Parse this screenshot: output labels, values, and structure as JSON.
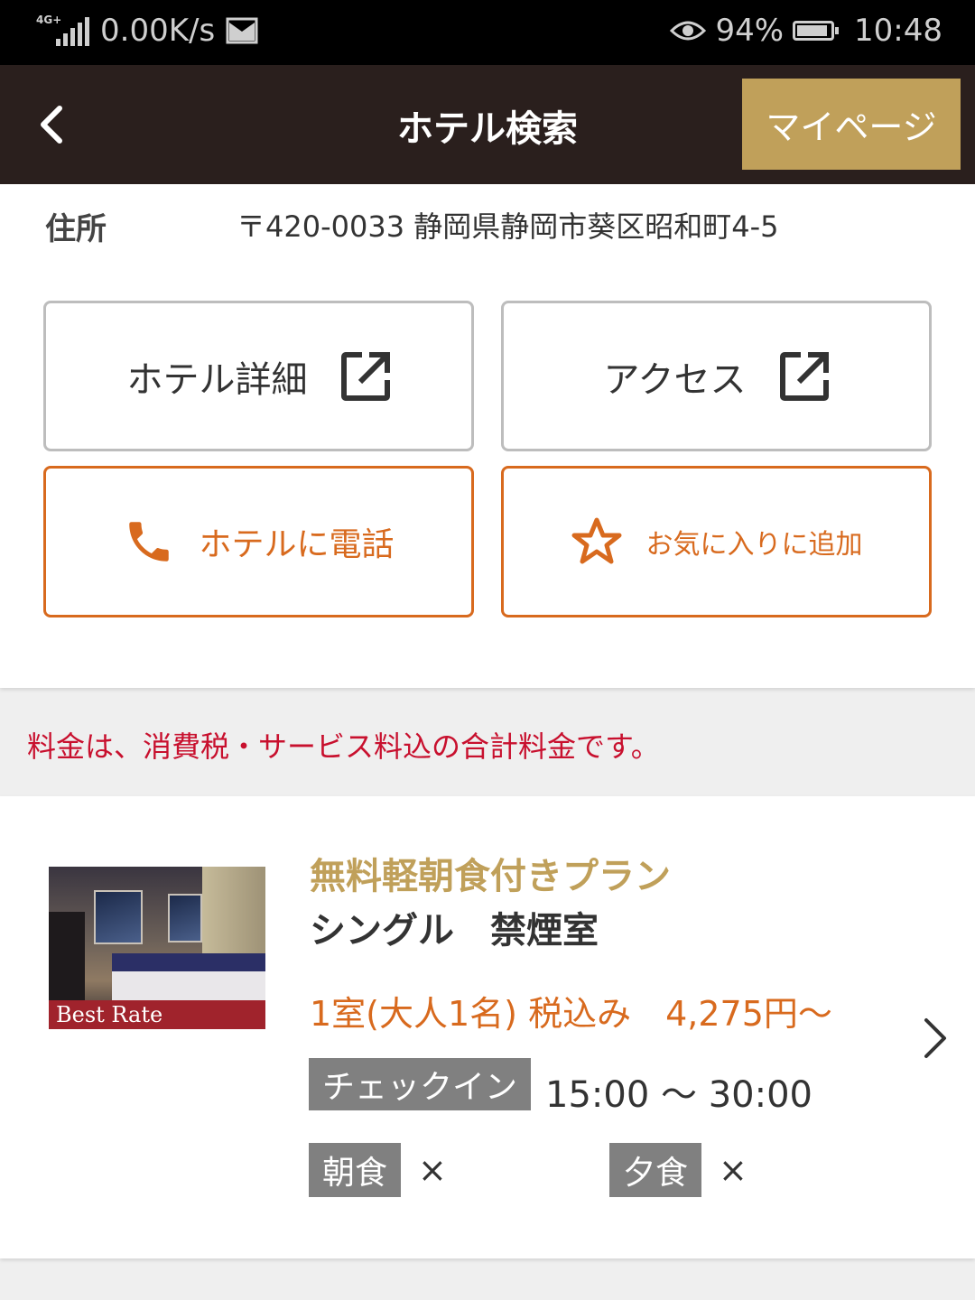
{
  "status_bar": {
    "network": "4G+",
    "speed": "0.00K/s",
    "battery": "94%",
    "time": "10:48",
    "icons": [
      "signal-icon",
      "mail-icon",
      "eye-icon",
      "battery-icon"
    ]
  },
  "header": {
    "title": "ホテル検索",
    "mypage_label": "マイページ"
  },
  "address": {
    "label": "住所",
    "value": "〒420-0033 静岡県静岡市葵区昭和町4-5"
  },
  "buttons": {
    "hotel_detail": "ホテル詳細",
    "access": "アクセス",
    "call": "ホテルに電話",
    "favorite": "お気に入りに追加"
  },
  "notice": "料金は、消費税・サービス料込の合計料金です。",
  "plan": {
    "badge": "Best Rate",
    "name": "無料軽朝食付きプラン",
    "room": "シングル　禁煙室",
    "price": "1室(大人1名) 税込み　4,275円〜",
    "checkin_label": "チェックイン",
    "checkin_value": "15:00 〜 30:00",
    "breakfast_label": "朝食",
    "breakfast_value": "×",
    "dinner_label": "夕食",
    "dinner_value": "×"
  },
  "colors": {
    "header_bg": "#2a1f1d",
    "gold": "#c0a05a",
    "orange": "#d86a1e",
    "notice_red": "#c8102e",
    "tag_gray": "#808080"
  }
}
